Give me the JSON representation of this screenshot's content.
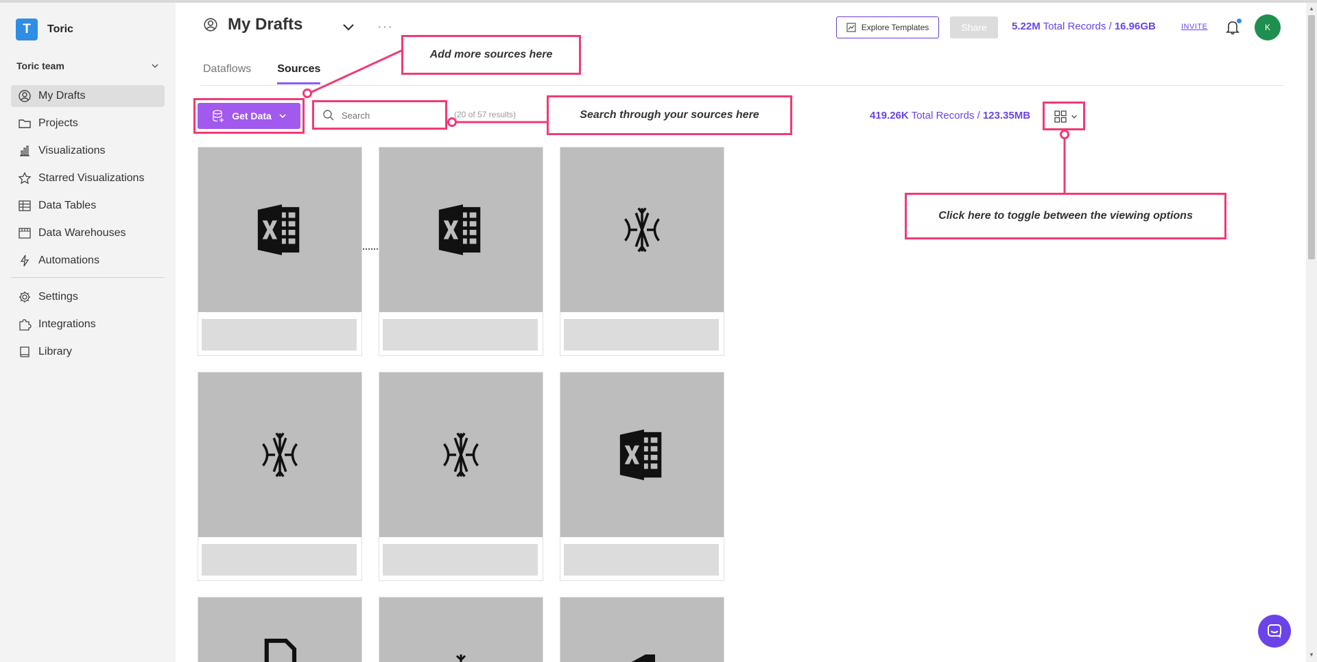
{
  "brand": {
    "logo_letter": "T",
    "name": "Toric"
  },
  "team": {
    "name": "Toric team"
  },
  "nav": {
    "items": [
      {
        "label": "My Drafts",
        "icon": "user-circle-icon",
        "active": true
      },
      {
        "label": "Projects",
        "icon": "folder-icon"
      },
      {
        "label": "Visualizations",
        "icon": "chart-icon"
      },
      {
        "label": "Starred Visualizations",
        "icon": "star-icon"
      },
      {
        "label": "Data Tables",
        "icon": "table-icon"
      },
      {
        "label": "Data Warehouses",
        "icon": "warehouse-icon"
      },
      {
        "label": "Automations",
        "icon": "lightning-icon"
      }
    ],
    "secondary": [
      {
        "label": "Settings",
        "icon": "gear-icon"
      },
      {
        "label": "Integrations",
        "icon": "puzzle-icon"
      },
      {
        "label": "Library",
        "icon": "book-icon"
      }
    ]
  },
  "header": {
    "title": "My Drafts",
    "explore_label": "Explore Templates",
    "share_label": "Share",
    "records_count": "5.22M",
    "records_label": "Total Records /",
    "records_size": "16.96GB",
    "invite_label": "INVITE",
    "avatar_initial": "K"
  },
  "tabs": [
    {
      "label": "Dataflows",
      "active": false
    },
    {
      "label": "Sources",
      "active": true
    }
  ],
  "toolbar": {
    "get_data_label": "Get Data",
    "search_placeholder": "Search",
    "results_text": "(20 of 57 results)",
    "records_count": "419.26K",
    "records_label": "Total Records /",
    "records_size": "123.35MB"
  },
  "cards": [
    {
      "icon": "excel-icon"
    },
    {
      "icon": "excel-icon"
    },
    {
      "icon": "snowflake-icon"
    },
    {
      "icon": "snowflake-icon"
    },
    {
      "icon": "snowflake-icon"
    },
    {
      "icon": "excel-icon"
    },
    {
      "icon": "file-icon"
    },
    {
      "icon": "snowflake-icon"
    },
    {
      "icon": "excel-icon"
    }
  ],
  "annotations": {
    "add_sources": "Add more sources here",
    "search_sources": "Search through your sources here",
    "toggle_view": "Click here to toggle between the viewing options"
  },
  "colors": {
    "accent": "#a259ee",
    "records": "#6a44e8",
    "annotation": "#f03a73",
    "avatar": "#1f8f4f",
    "brand": "#2f8de4"
  }
}
